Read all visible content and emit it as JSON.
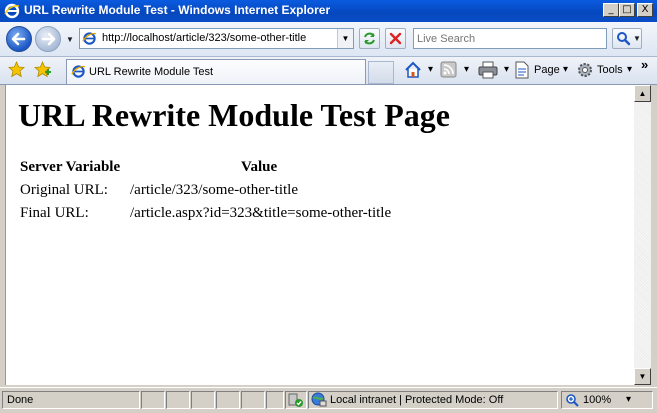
{
  "window": {
    "title": "URL Rewrite Module Test - Windows Internet Explorer",
    "minimize_glyph": "_",
    "maximize_glyph": "□",
    "close_glyph": "X"
  },
  "navbar": {
    "address": "http://localhost/article/323/some-other-title",
    "search_placeholder": "Live Search"
  },
  "tabbar": {
    "tab_label": "URL Rewrite Module Test",
    "commands": [
      {
        "label": "Page",
        "icon": "page-icon"
      },
      {
        "label": "Tools",
        "icon": "gear-icon"
      }
    ],
    "overflow_glyph": "»"
  },
  "page": {
    "heading": "URL Rewrite Module Test Page",
    "table": {
      "headers": [
        "Server Variable",
        "Value"
      ],
      "rows": [
        {
          "name": "Original URL:",
          "value": "/article/323/some-other-title"
        },
        {
          "name": "Final URL:",
          "value": "/article.aspx?id=323&title=some-other-title"
        }
      ]
    }
  },
  "status": {
    "text": "Done",
    "zone": "Local intranet | Protected Mode: Off",
    "zoom": "100%"
  },
  "colors": {
    "titlebar": "#0a5be0",
    "accent": "#1b56c4"
  }
}
